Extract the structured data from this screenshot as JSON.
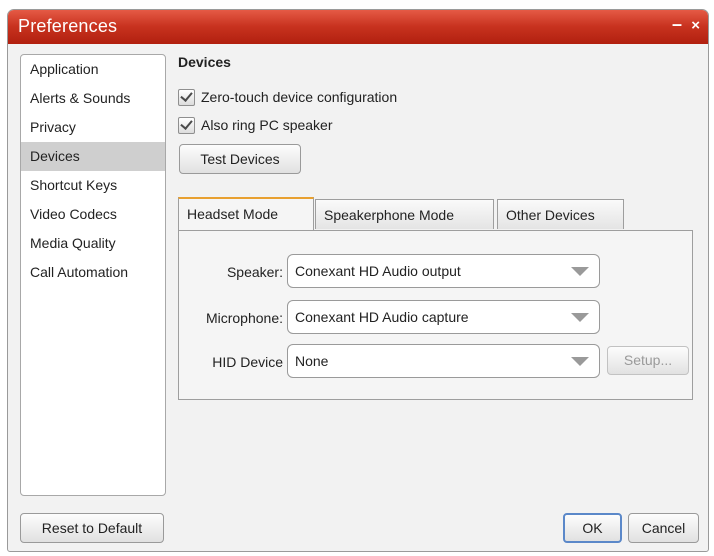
{
  "window": {
    "title": "Preferences",
    "minimize_glyph": "–",
    "close_glyph": "×"
  },
  "sidebar": {
    "items": [
      {
        "label": "Application"
      },
      {
        "label": "Alerts & Sounds"
      },
      {
        "label": "Privacy"
      },
      {
        "label": "Devices"
      },
      {
        "label": "Shortcut Keys"
      },
      {
        "label": "Video Codecs"
      },
      {
        "label": "Media Quality"
      },
      {
        "label": "Call Automation"
      }
    ],
    "selected": "Devices"
  },
  "main": {
    "heading": "Devices",
    "checkboxes": [
      {
        "label": "Zero-touch device configuration",
        "checked": true
      },
      {
        "label": "Also ring PC speaker",
        "checked": true
      }
    ],
    "test_button": "Test Devices",
    "tabs": [
      {
        "label": "Headset Mode",
        "active": true
      },
      {
        "label": "Speakerphone Mode",
        "active": false
      },
      {
        "label": "Other Devices",
        "active": false
      }
    ],
    "fields": [
      {
        "label": "Speaker:",
        "value": "Conexant HD Audio output"
      },
      {
        "label": "Microphone:",
        "value": "Conexant HD Audio capture"
      },
      {
        "label": "HID Device",
        "value": "None"
      }
    ],
    "setup_button": "Setup..."
  },
  "footer": {
    "reset_button": "Reset to Default",
    "ok_button": "OK",
    "cancel_button": "Cancel"
  }
}
